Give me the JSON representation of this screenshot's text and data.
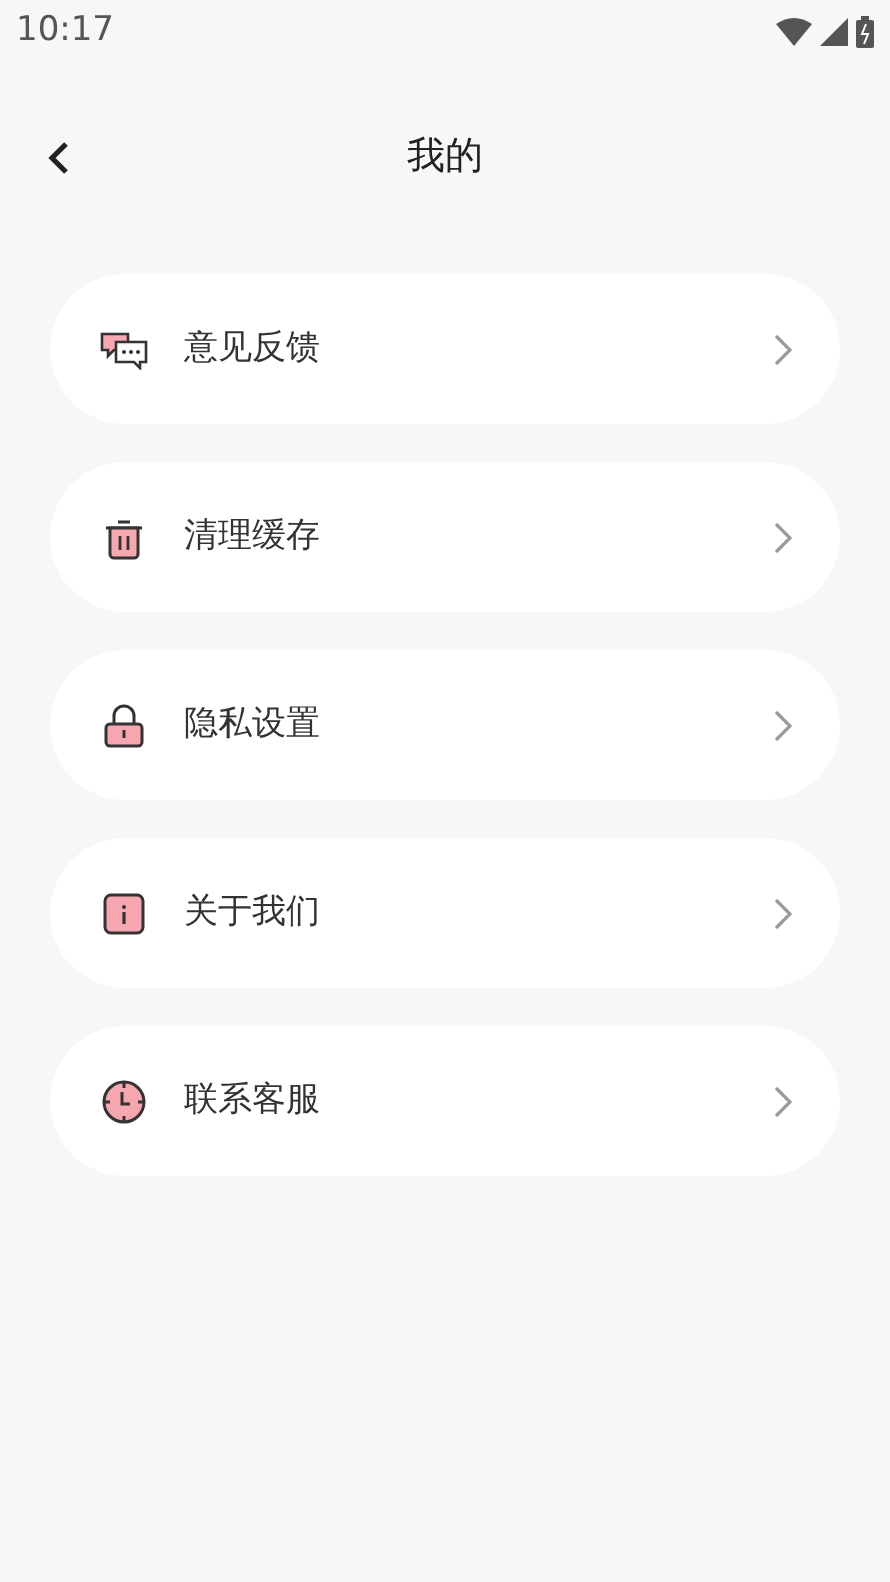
{
  "status_bar": {
    "time": "10:17"
  },
  "header": {
    "title": "我的"
  },
  "menu": [
    {
      "label": "意见反馈",
      "kind": "chat"
    },
    {
      "label": "清理缓存",
      "kind": "trash"
    },
    {
      "label": "隐私设置",
      "kind": "lock"
    },
    {
      "label": "关于我们",
      "kind": "info"
    },
    {
      "label": "联系客服",
      "kind": "clock"
    }
  ]
}
